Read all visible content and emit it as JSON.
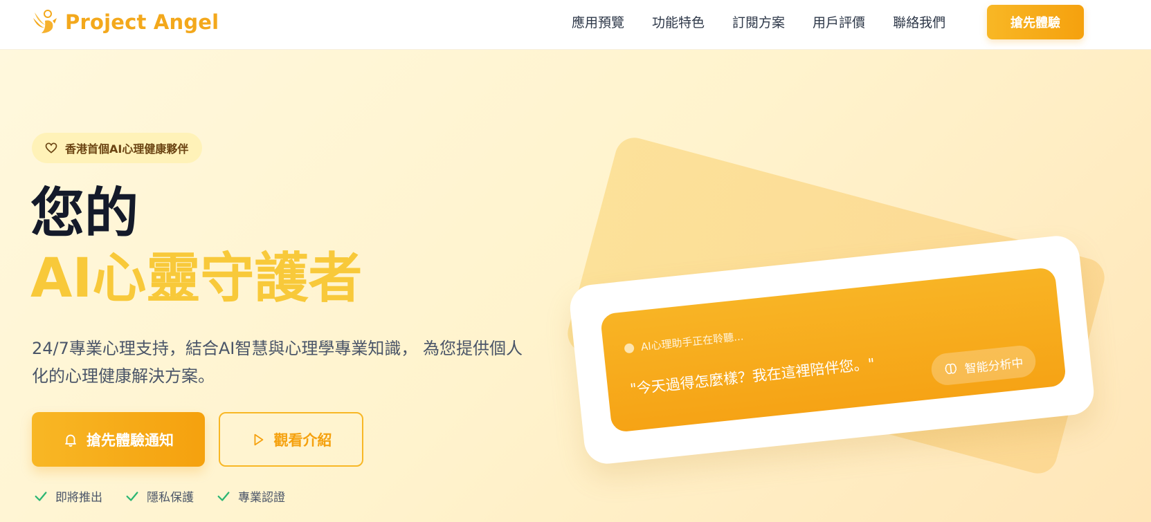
{
  "brand": {
    "name": "Project Angel",
    "icon": "angel-icon",
    "color": "#f3a81c"
  },
  "nav": {
    "items": [
      {
        "label": "應用預覽"
      },
      {
        "label": "功能特色"
      },
      {
        "label": "訂閱方案"
      },
      {
        "label": "用戶評價"
      },
      {
        "label": "聯絡我們"
      }
    ],
    "cta_label": "搶先體驗"
  },
  "hero": {
    "badge": {
      "icon": "heart-icon",
      "label": "香港首個AI心理健康夥伴"
    },
    "title_line1": "您的",
    "title_line2": "AI心靈守護者",
    "description": "24/7專業心理支持，結合AI智慧與心理學專業知識， 為您提供個人化的心理健康解決方案。",
    "primary_button": {
      "icon": "bell-icon",
      "label": "搶先體驗通知"
    },
    "secondary_button": {
      "icon": "play-icon",
      "label": "觀看介紹"
    },
    "features": [
      {
        "icon": "check-icon",
        "label": "即將推出"
      },
      {
        "icon": "check-icon",
        "label": "隱私保護"
      },
      {
        "icon": "check-icon",
        "label": "專業認證"
      }
    ]
  },
  "card": {
    "status": "AI心理助手正在聆聽...",
    "quote": "\"今天過得怎麼樣？我在這裡陪伴您。\"",
    "chip": {
      "icon": "brain-icon",
      "label": "智能分析中"
    }
  },
  "colors": {
    "accent": "#f5a10e",
    "accent_light": "#f8c93a",
    "title_dark": "#141a2a",
    "check_green": "#2bb673"
  }
}
